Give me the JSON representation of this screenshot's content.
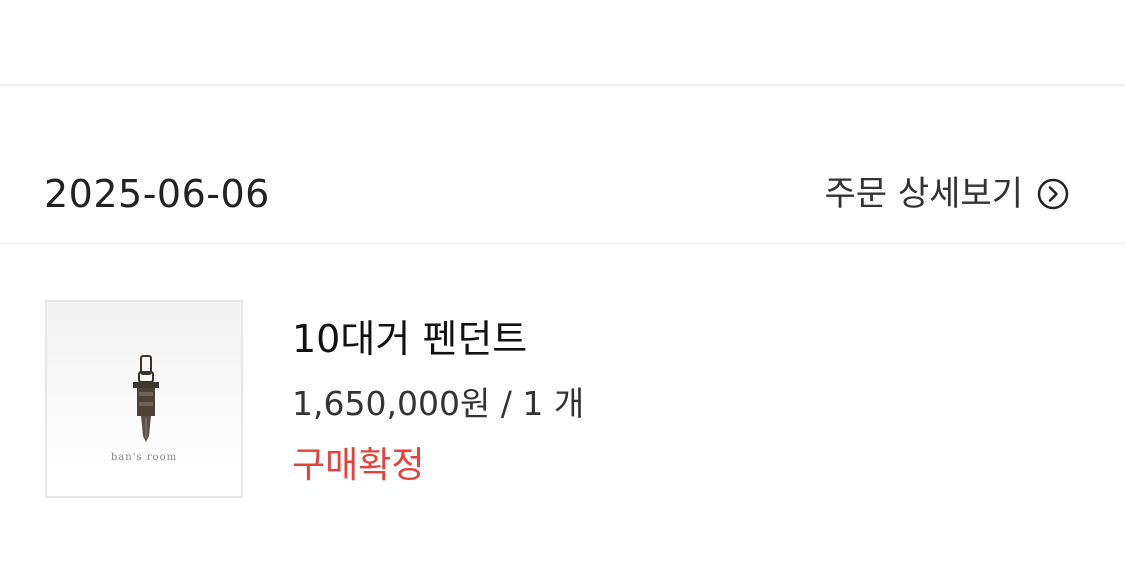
{
  "order": {
    "date": "2025-06-06",
    "detail_link_label": "주문 상세보기"
  },
  "item": {
    "name": "10대거 펜던트",
    "price_qty": "1,650,000원 / 1 개",
    "status": "구매확정",
    "thumbnail_caption": "ban's room"
  },
  "colors": {
    "status": "#e5403a",
    "divider": "#eeeeee"
  },
  "icons": {
    "detail_link": "chevron-right-circle-icon"
  }
}
